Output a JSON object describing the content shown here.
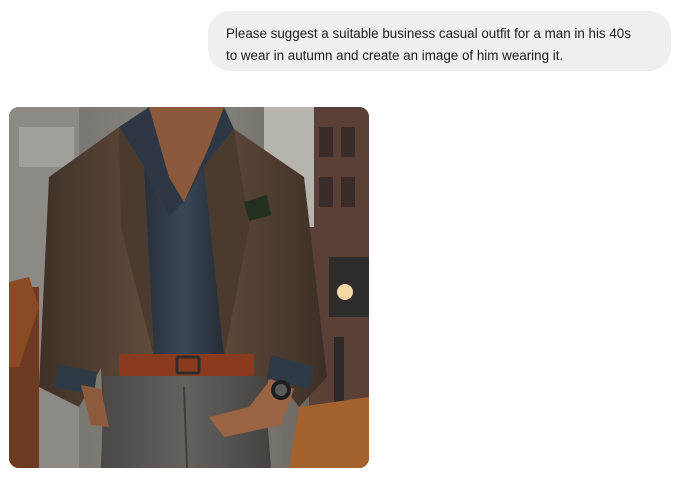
{
  "chat": {
    "user_message": {
      "line1": "Please suggest a suitable business casual outfit for a man in his 40s",
      "line2": "to wear in autumn and create an image of him wearing it."
    },
    "generated_image": {
      "subject": "man-in-business-casual-outfit",
      "colors": {
        "blazer": "#5a4536",
        "shirt": "#2f3a47",
        "belt": "#8a3b1e",
        "trousers": "#54524f",
        "background": "#7d7a74"
      }
    }
  }
}
